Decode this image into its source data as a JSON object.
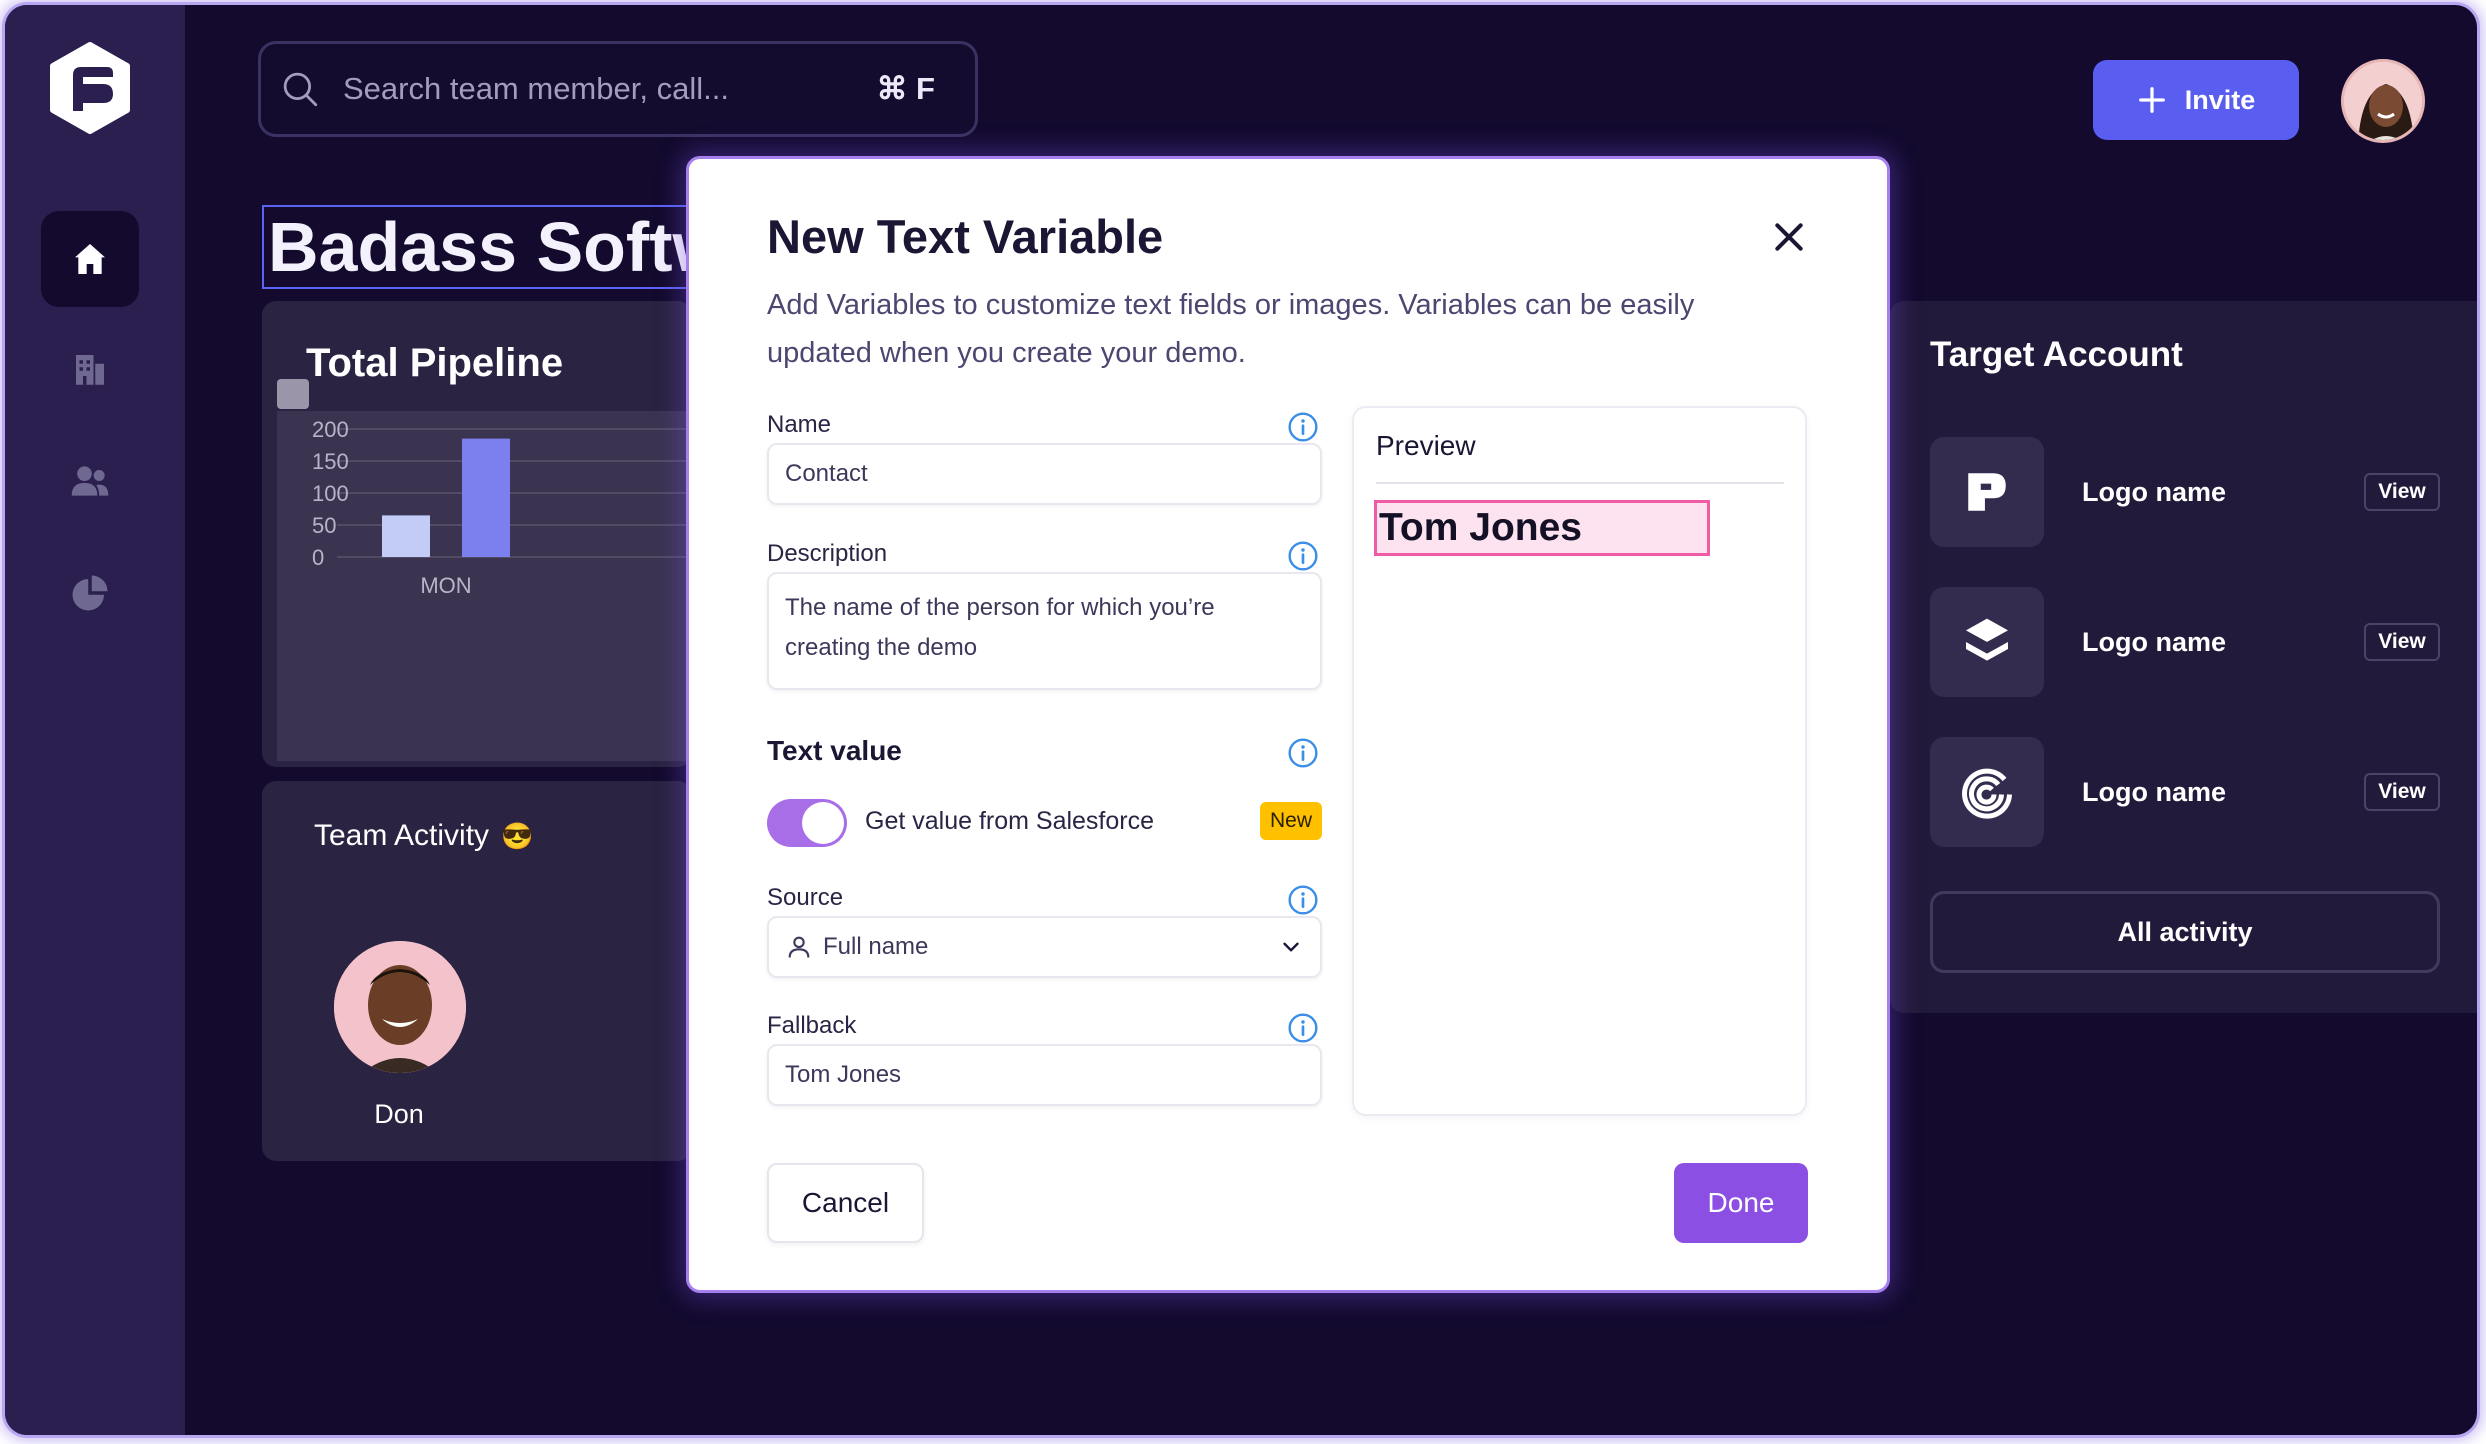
{
  "search": {
    "placeholder": "Search team member, call...",
    "shortcut": "⌘ F"
  },
  "header": {
    "invite_label": "Invite"
  },
  "page": {
    "title": "Badass Software"
  },
  "pipeline": {
    "title": "Total Pipeline"
  },
  "chart_data": {
    "type": "bar",
    "title": "",
    "categories": [
      "MON"
    ],
    "series": [
      {
        "values": [
          65
        ],
        "color": "#c3ccf6"
      },
      {
        "values": [
          185
        ],
        "color": "#7b80ee"
      }
    ],
    "yticks": [
      200,
      150,
      100,
      50,
      0
    ],
    "ylim": [
      0,
      200
    ],
    "grid": true
  },
  "activity": {
    "title": "Team Activity",
    "emoji": "😎",
    "member_name": "Don"
  },
  "target": {
    "title": "Target Account",
    "accounts": [
      {
        "name": "Logo name",
        "view": "View"
      },
      {
        "name": "Logo name",
        "view": "View"
      },
      {
        "name": "Logo name",
        "view": "View"
      }
    ],
    "all_activity": "All activity"
  },
  "modal": {
    "title": "New Text Variable",
    "subtitle": "Add Variables to customize text fields or images. Variables can be easily updated when you create your demo.",
    "name_label": "Name",
    "name_value": "Contact",
    "description_label": "Description",
    "description_value": "The name of the person for which you’re creating the demo",
    "text_value_label": "Text value",
    "toggle_label": "Get value from Salesforce",
    "toggle_on": true,
    "new_badge": "New",
    "source_label": "Source",
    "source_value": "Full name",
    "fallback_label": "Fallback",
    "fallback_value": "Tom Jones",
    "preview_title": "Preview",
    "preview_value": "Tom Jones",
    "cancel_label": "Cancel",
    "done_label": "Done"
  },
  "colors": {
    "accent": "#5a5ef0",
    "primary_button": "#8b4fe3",
    "badge": "#ffc000",
    "highlight": "#ee5da3"
  }
}
